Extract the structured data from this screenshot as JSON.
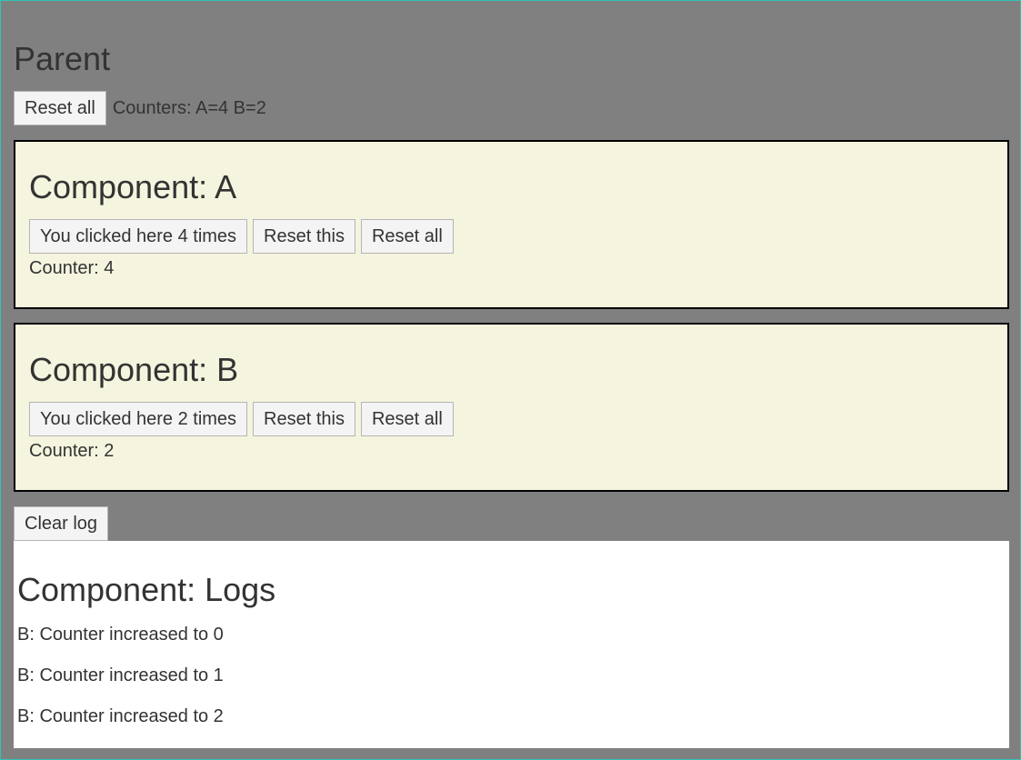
{
  "parent": {
    "title": "Parent",
    "reset_all_label": "Reset all",
    "counters_text": "Counters: A=4 B=2"
  },
  "components": [
    {
      "title": "Component: A",
      "click_label": "You clicked here 4 times",
      "reset_this_label": "Reset this",
      "reset_all_label": "Reset all",
      "counter_text": "Counter: 4"
    },
    {
      "title": "Component: B",
      "click_label": "You clicked here 2 times",
      "reset_this_label": "Reset this",
      "reset_all_label": "Reset all",
      "counter_text": "Counter: 2"
    }
  ],
  "clear_log_label": "Clear log",
  "logs": {
    "title": "Component: Logs",
    "entries": [
      "B: Counter increased to 0",
      "B: Counter increased to 1",
      "B: Counter increased to 2"
    ]
  },
  "colors": {
    "page_background": "#808080",
    "component_background": "#f5f4de",
    "logs_background": "#ffffff",
    "frame_border": "#2ec4b6"
  }
}
